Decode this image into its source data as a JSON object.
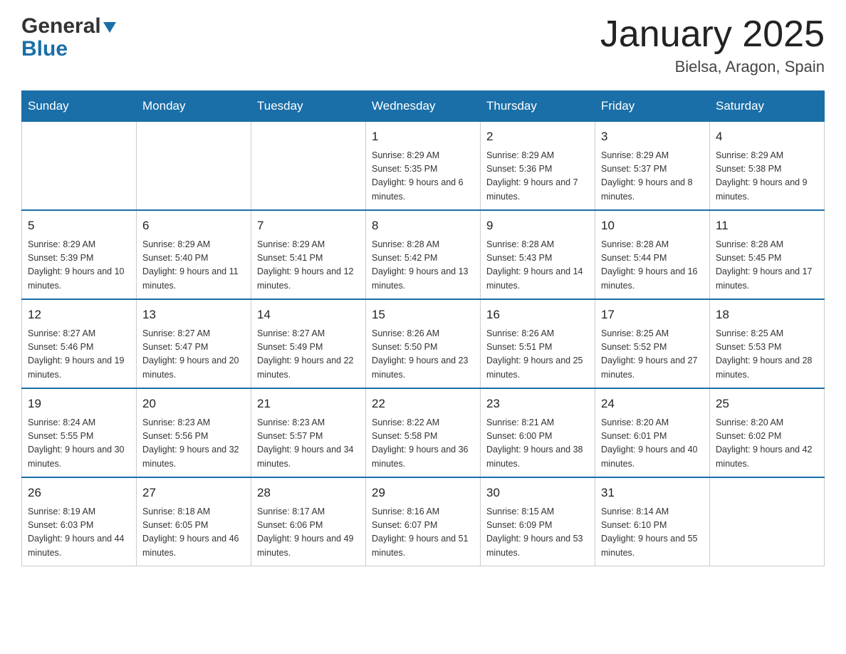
{
  "header": {
    "logo_general": "General",
    "logo_blue": "Blue",
    "month_title": "January 2025",
    "location": "Bielsa, Aragon, Spain"
  },
  "calendar": {
    "days_of_week": [
      "Sunday",
      "Monday",
      "Tuesday",
      "Wednesday",
      "Thursday",
      "Friday",
      "Saturday"
    ],
    "weeks": [
      [
        {
          "day": "",
          "info": ""
        },
        {
          "day": "",
          "info": ""
        },
        {
          "day": "",
          "info": ""
        },
        {
          "day": "1",
          "info": "Sunrise: 8:29 AM\nSunset: 5:35 PM\nDaylight: 9 hours and 6 minutes."
        },
        {
          "day": "2",
          "info": "Sunrise: 8:29 AM\nSunset: 5:36 PM\nDaylight: 9 hours and 7 minutes."
        },
        {
          "day": "3",
          "info": "Sunrise: 8:29 AM\nSunset: 5:37 PM\nDaylight: 9 hours and 8 minutes."
        },
        {
          "day": "4",
          "info": "Sunrise: 8:29 AM\nSunset: 5:38 PM\nDaylight: 9 hours and 9 minutes."
        }
      ],
      [
        {
          "day": "5",
          "info": "Sunrise: 8:29 AM\nSunset: 5:39 PM\nDaylight: 9 hours and 10 minutes."
        },
        {
          "day": "6",
          "info": "Sunrise: 8:29 AM\nSunset: 5:40 PM\nDaylight: 9 hours and 11 minutes."
        },
        {
          "day": "7",
          "info": "Sunrise: 8:29 AM\nSunset: 5:41 PM\nDaylight: 9 hours and 12 minutes."
        },
        {
          "day": "8",
          "info": "Sunrise: 8:28 AM\nSunset: 5:42 PM\nDaylight: 9 hours and 13 minutes."
        },
        {
          "day": "9",
          "info": "Sunrise: 8:28 AM\nSunset: 5:43 PM\nDaylight: 9 hours and 14 minutes."
        },
        {
          "day": "10",
          "info": "Sunrise: 8:28 AM\nSunset: 5:44 PM\nDaylight: 9 hours and 16 minutes."
        },
        {
          "day": "11",
          "info": "Sunrise: 8:28 AM\nSunset: 5:45 PM\nDaylight: 9 hours and 17 minutes."
        }
      ],
      [
        {
          "day": "12",
          "info": "Sunrise: 8:27 AM\nSunset: 5:46 PM\nDaylight: 9 hours and 19 minutes."
        },
        {
          "day": "13",
          "info": "Sunrise: 8:27 AM\nSunset: 5:47 PM\nDaylight: 9 hours and 20 minutes."
        },
        {
          "day": "14",
          "info": "Sunrise: 8:27 AM\nSunset: 5:49 PM\nDaylight: 9 hours and 22 minutes."
        },
        {
          "day": "15",
          "info": "Sunrise: 8:26 AM\nSunset: 5:50 PM\nDaylight: 9 hours and 23 minutes."
        },
        {
          "day": "16",
          "info": "Sunrise: 8:26 AM\nSunset: 5:51 PM\nDaylight: 9 hours and 25 minutes."
        },
        {
          "day": "17",
          "info": "Sunrise: 8:25 AM\nSunset: 5:52 PM\nDaylight: 9 hours and 27 minutes."
        },
        {
          "day": "18",
          "info": "Sunrise: 8:25 AM\nSunset: 5:53 PM\nDaylight: 9 hours and 28 minutes."
        }
      ],
      [
        {
          "day": "19",
          "info": "Sunrise: 8:24 AM\nSunset: 5:55 PM\nDaylight: 9 hours and 30 minutes."
        },
        {
          "day": "20",
          "info": "Sunrise: 8:23 AM\nSunset: 5:56 PM\nDaylight: 9 hours and 32 minutes."
        },
        {
          "day": "21",
          "info": "Sunrise: 8:23 AM\nSunset: 5:57 PM\nDaylight: 9 hours and 34 minutes."
        },
        {
          "day": "22",
          "info": "Sunrise: 8:22 AM\nSunset: 5:58 PM\nDaylight: 9 hours and 36 minutes."
        },
        {
          "day": "23",
          "info": "Sunrise: 8:21 AM\nSunset: 6:00 PM\nDaylight: 9 hours and 38 minutes."
        },
        {
          "day": "24",
          "info": "Sunrise: 8:20 AM\nSunset: 6:01 PM\nDaylight: 9 hours and 40 minutes."
        },
        {
          "day": "25",
          "info": "Sunrise: 8:20 AM\nSunset: 6:02 PM\nDaylight: 9 hours and 42 minutes."
        }
      ],
      [
        {
          "day": "26",
          "info": "Sunrise: 8:19 AM\nSunset: 6:03 PM\nDaylight: 9 hours and 44 minutes."
        },
        {
          "day": "27",
          "info": "Sunrise: 8:18 AM\nSunset: 6:05 PM\nDaylight: 9 hours and 46 minutes."
        },
        {
          "day": "28",
          "info": "Sunrise: 8:17 AM\nSunset: 6:06 PM\nDaylight: 9 hours and 49 minutes."
        },
        {
          "day": "29",
          "info": "Sunrise: 8:16 AM\nSunset: 6:07 PM\nDaylight: 9 hours and 51 minutes."
        },
        {
          "day": "30",
          "info": "Sunrise: 8:15 AM\nSunset: 6:09 PM\nDaylight: 9 hours and 53 minutes."
        },
        {
          "day": "31",
          "info": "Sunrise: 8:14 AM\nSunset: 6:10 PM\nDaylight: 9 hours and 55 minutes."
        },
        {
          "day": "",
          "info": ""
        }
      ]
    ]
  }
}
